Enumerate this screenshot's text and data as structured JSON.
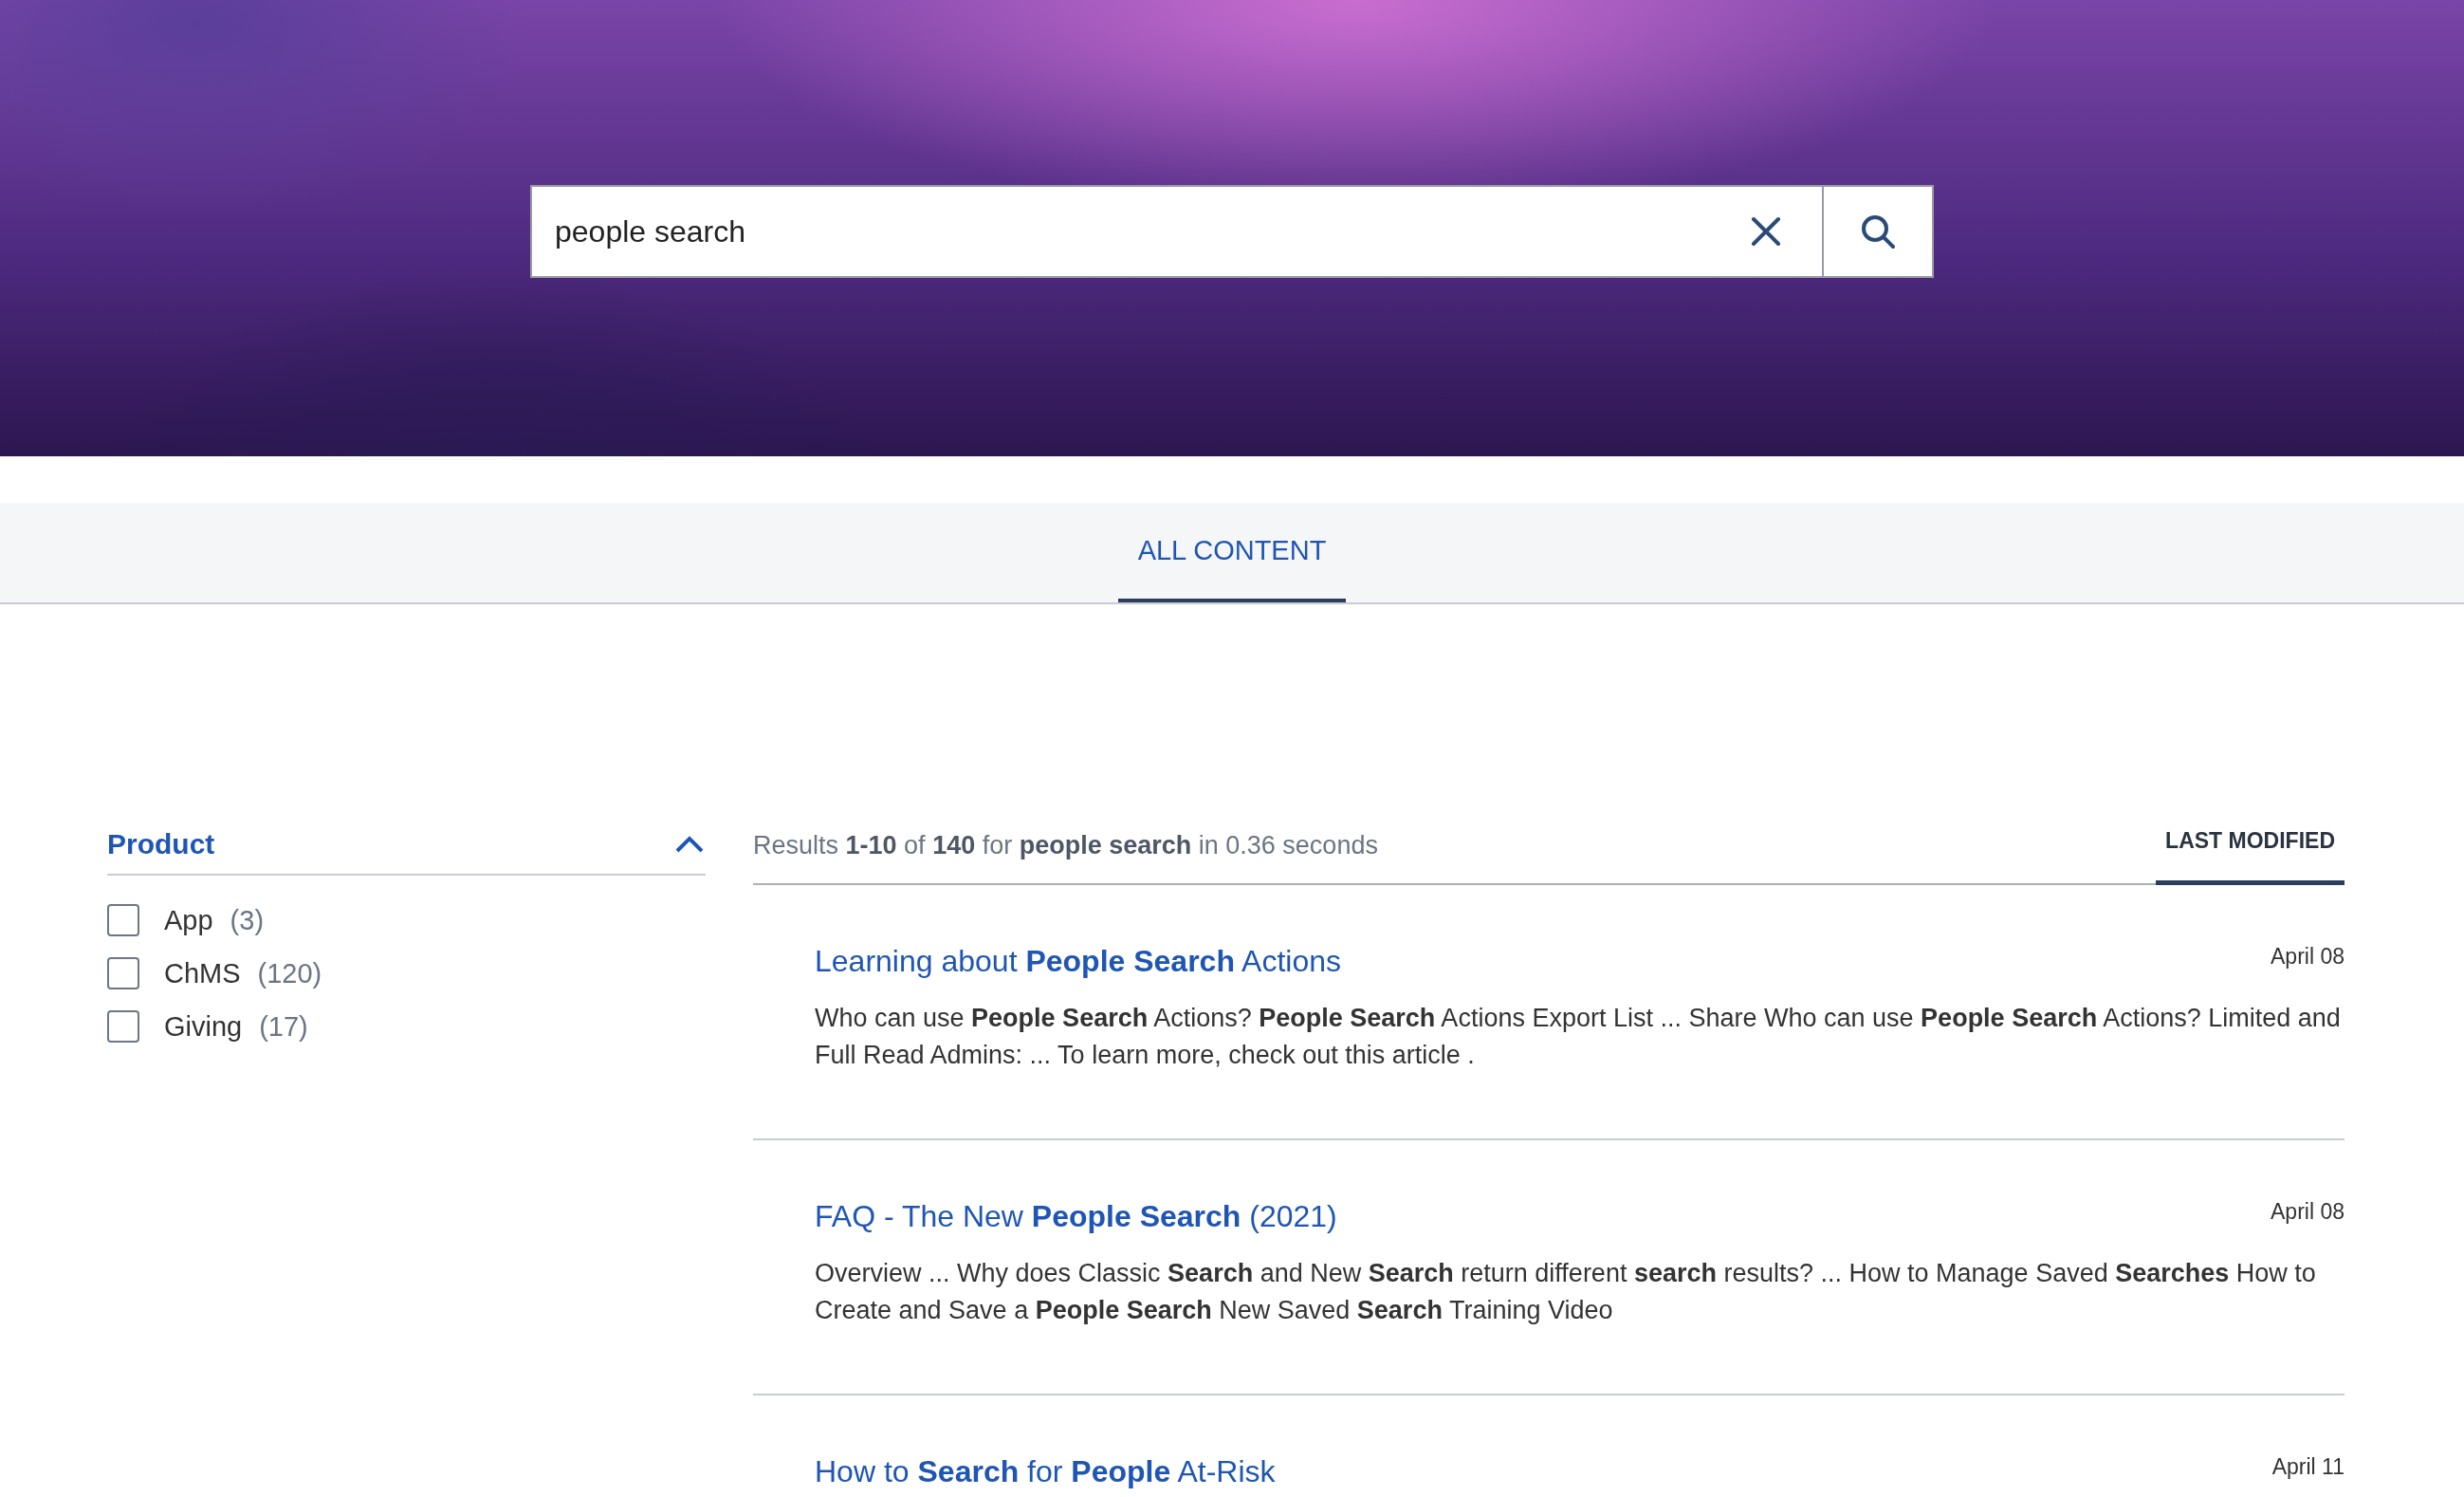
{
  "search": {
    "value": "people search"
  },
  "tabs": [
    {
      "label": "ALL CONTENT",
      "selected": true
    }
  ],
  "filter": {
    "title": "Product",
    "expanded": true,
    "options": [
      {
        "label": "App",
        "count": "(3)",
        "checked": false
      },
      {
        "label": "ChMS",
        "count": "(120)",
        "checked": false
      },
      {
        "label": "Giving",
        "count": "(17)",
        "checked": false
      }
    ]
  },
  "results": {
    "summary": "Results **1-10** of **140** for **people search** in 0.36 seconds",
    "sort": [
      {
        "label": "LAST MODIFIED",
        "selected": true
      }
    ],
    "items": [
      {
        "title": "Learning about **People Search** Actions",
        "date": "April 08",
        "snippet": "Who can use **People Search** Actions? **People Search** Actions Export List ... Share Who can use **People Search** Actions? Limited and Full Read Admins: ... To learn more, check out this article ."
      },
      {
        "title": "FAQ - The New **People Search** (2021)",
        "date": "April 08",
        "snippet": "Overview ... Why does Classic **Search** and New **Search** return different **search** results? ... How to Manage Saved **Searches** How to Create and Save a **People Search** New Saved **Search** Training Video"
      },
      {
        "title": "How to **Search** for **People** At-Risk",
        "date": "April 11"
      }
    ]
  }
}
